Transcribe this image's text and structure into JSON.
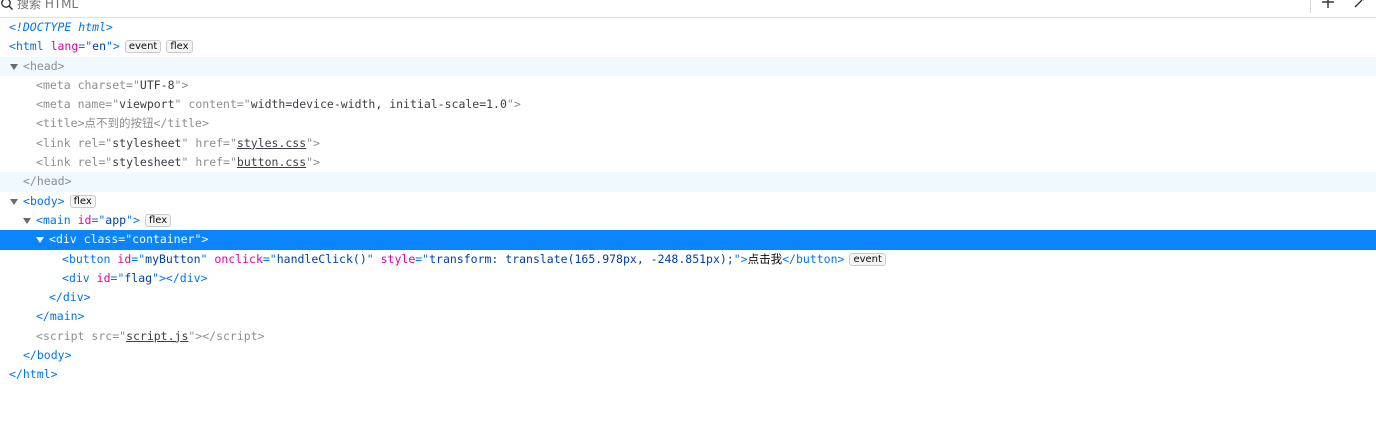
{
  "toolbar": {
    "search_placeholder": "搜索 HTML"
  },
  "colors": {
    "selection": "#0a84ff",
    "tag": "#0074e8",
    "attr_name": "#dd00a9",
    "attr_value": "#003eaa",
    "highlight_row": "#f0f9fe"
  },
  "tree": {
    "doctype": "<!DOCTYPE html>",
    "html": {
      "tag": "html",
      "attr_lang": "lang",
      "val_lang": "en",
      "badge_event": "event",
      "badge_flex": "flex",
      "close": "html"
    },
    "head": {
      "tag": "head",
      "close": "head"
    },
    "meta1": {
      "tag": "meta",
      "attr": "charset",
      "val": "UTF-8"
    },
    "meta2": {
      "tag": "meta",
      "attr1": "name",
      "val1": "viewport",
      "attr2": "content",
      "val2": "width=device-width, initial-scale=1.0"
    },
    "title": {
      "tag": "title",
      "text": "点不到的按钮",
      "close": "title"
    },
    "link1": {
      "tag": "link",
      "attr1": "rel",
      "val1": "stylesheet",
      "attr2": "href",
      "val2": "styles.css"
    },
    "link2": {
      "tag": "link",
      "attr1": "rel",
      "val1": "stylesheet",
      "attr2": "href",
      "val2": "button.css"
    },
    "body": {
      "tag": "body",
      "badge_flex": "flex",
      "close": "body"
    },
    "main": {
      "tag": "main",
      "attr": "id",
      "val": "app",
      "badge_flex": "flex",
      "close": "main"
    },
    "container": {
      "tag": "div",
      "attr": "class",
      "val": "container",
      "close": "div"
    },
    "button": {
      "tag": "button",
      "attr1": "id",
      "val1": "myButton",
      "attr2": "onclick",
      "val2": "handleClick()",
      "attr3": "style",
      "val3": "transform: translate(165.978px, -248.851px);",
      "text": "点击我",
      "close": "button",
      "badge_event": "event"
    },
    "flag": {
      "tag": "div",
      "attr": "id",
      "val": "flag",
      "close": "div"
    },
    "script": {
      "tag": "script",
      "attr": "src",
      "val": "script.js",
      "close": "script"
    }
  }
}
